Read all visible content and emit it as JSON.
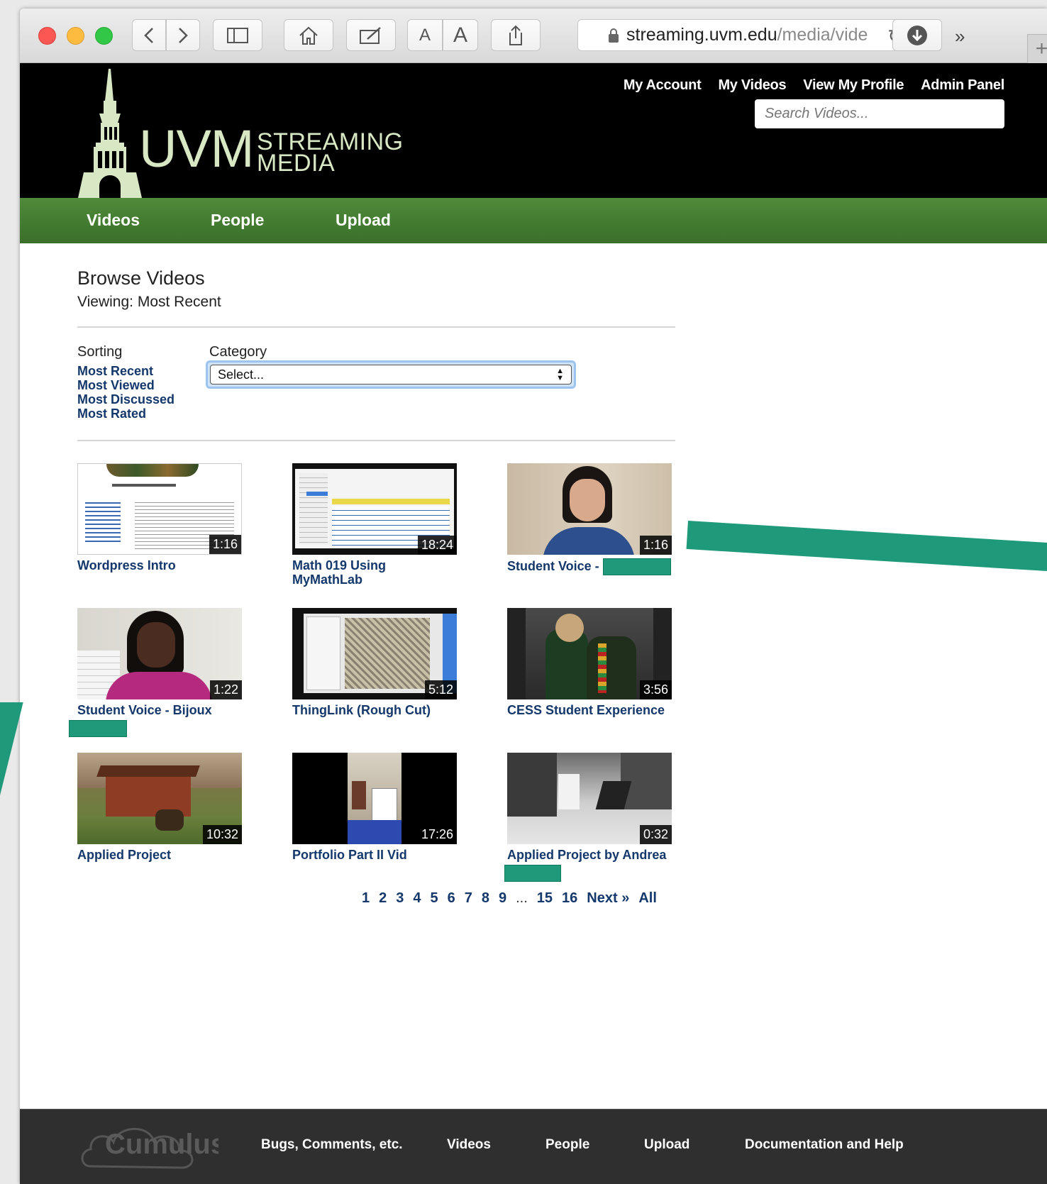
{
  "browser": {
    "url_domain": "streaming.uvm.edu",
    "url_path": "/media/vide",
    "font_small": "A",
    "font_large": "A"
  },
  "header": {
    "logo_uvm": "UVM",
    "logo_streaming": "STREAMING",
    "logo_media": "MEDIA",
    "links": [
      "My Account",
      "My Videos",
      "View My Profile",
      "Admin Panel"
    ],
    "search_placeholder": "Search Videos..."
  },
  "nav": {
    "items": [
      "Videos",
      "People",
      "Upload"
    ]
  },
  "main": {
    "title": "Browse Videos",
    "viewing": "Viewing: Most Recent",
    "sorting_label": "Sorting",
    "sorting_links": [
      "Most Recent",
      "Most Viewed",
      "Most Discussed",
      "Most Rated"
    ],
    "category_label": "Category",
    "category_selected": "Select..."
  },
  "videos": [
    {
      "title": "Wordpress Intro",
      "duration": "1:16"
    },
    {
      "title": "Math 019 Using MyMathLab",
      "duration": "18:24"
    },
    {
      "title": "Student Voice -",
      "duration": "1:16"
    },
    {
      "title": "Student Voice - Bijoux",
      "duration": "1:22"
    },
    {
      "title": "ThingLink (Rough Cut)",
      "duration": "5:12"
    },
    {
      "title": "CESS Student Experience",
      "duration": "3:56"
    },
    {
      "title": "Applied Project",
      "duration": "10:32"
    },
    {
      "title": "Portfolio Part II Vid",
      "duration": "17:26"
    },
    {
      "title": "Applied Project by Andrea",
      "duration": "0:32"
    }
  ],
  "pagination": {
    "pages": [
      "1",
      "2",
      "3",
      "4",
      "5",
      "6",
      "7",
      "8",
      "9"
    ],
    "ellipsis": "...",
    "last_pages": [
      "15",
      "16"
    ],
    "next": "Next »",
    "all": "All"
  },
  "footer": {
    "logo": "Cumulus",
    "links": [
      "Bugs, Comments, etc.",
      "Videos",
      "People",
      "Upload",
      "Documentation and Help"
    ]
  },
  "colors": {
    "header_bg": "#000000",
    "nav_green": "#3f7530",
    "link_blue": "#14386b",
    "annotation_teal": "#1e9a7a",
    "footer_bg": "#2f2f2f"
  }
}
